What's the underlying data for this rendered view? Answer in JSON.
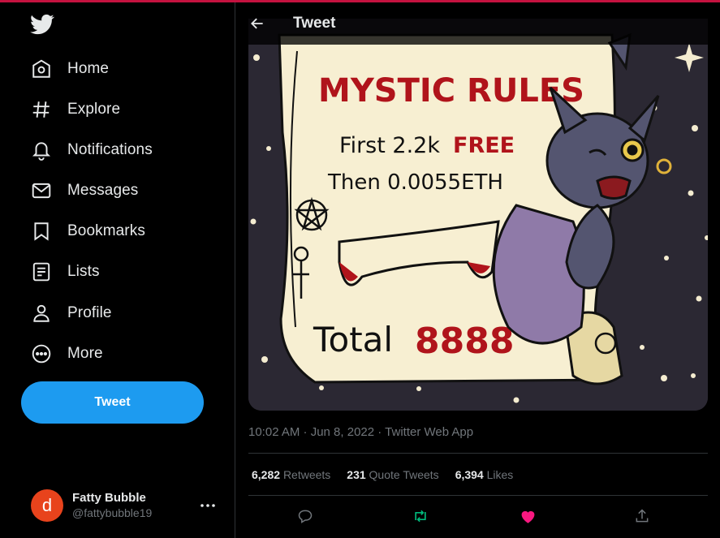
{
  "sidebar": {
    "logo_icon": "twitter-bird-icon",
    "items": [
      {
        "label": "Home",
        "icon": "home-icon"
      },
      {
        "label": "Explore",
        "icon": "hashtag-icon"
      },
      {
        "label": "Notifications",
        "icon": "bell-icon"
      },
      {
        "label": "Messages",
        "icon": "envelope-icon"
      },
      {
        "label": "Bookmarks",
        "icon": "bookmark-icon"
      },
      {
        "label": "Lists",
        "icon": "list-icon"
      },
      {
        "label": "Profile",
        "icon": "person-icon"
      },
      {
        "label": "More",
        "icon": "more-circle-icon"
      }
    ],
    "tweet_button": "Tweet",
    "account": {
      "avatar_letter": "d",
      "name": "Fatty Bubble",
      "handle": "@fattybubble19"
    }
  },
  "main": {
    "header_title": "Tweet",
    "media": {
      "title": "MYSTIC RULES",
      "line1_a": "First 2.2k",
      "line1_b": "FREE",
      "line2": "Then 0.0055ETH",
      "total_label": "Total",
      "total_value": "8888"
    },
    "meta": "10:02 AM · Jun 8, 2022 · Twitter Web App",
    "stats": [
      {
        "count": "6,282",
        "label": "Retweets"
      },
      {
        "count": "231",
        "label": "Quote Tweets"
      },
      {
        "count": "6,394",
        "label": "Likes"
      }
    ]
  },
  "colors": {
    "accent": "#1d9bf0",
    "like": "#f91880",
    "retweet": "#00ba7c",
    "background": "#000000"
  }
}
